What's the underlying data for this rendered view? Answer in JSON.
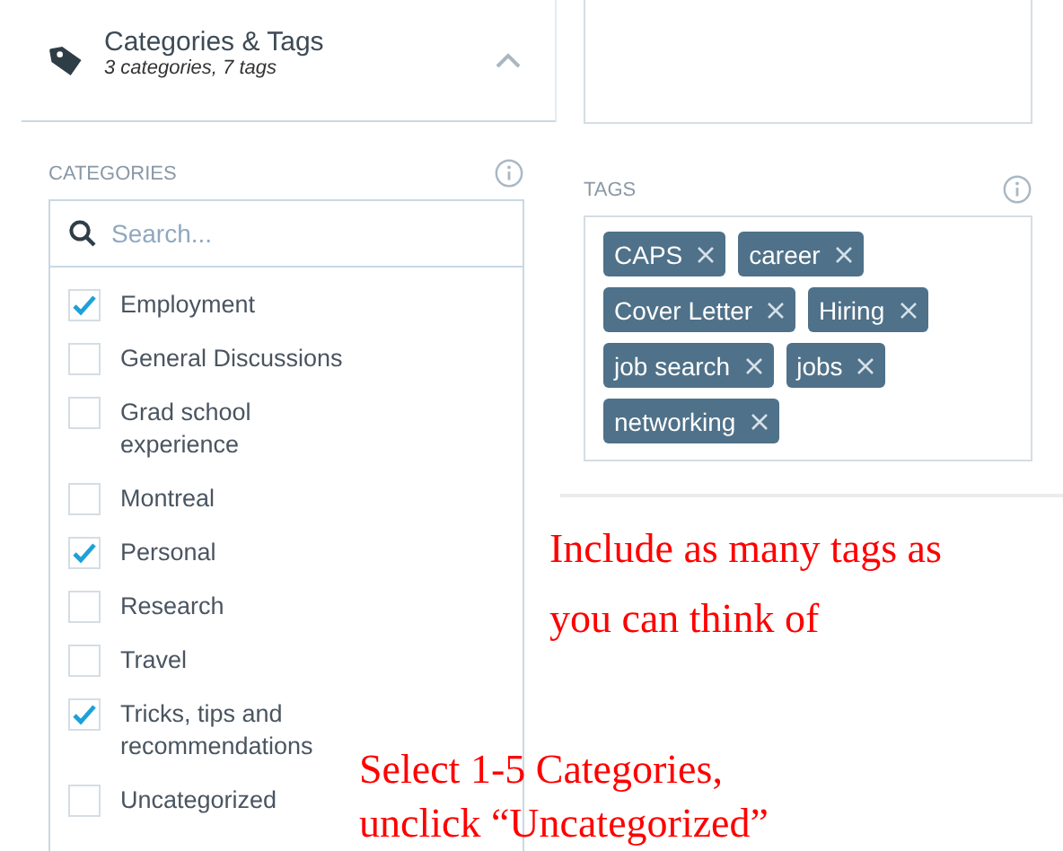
{
  "header": {
    "title": "Categories & Tags",
    "subtitle": "3 categories, 7 tags",
    "expanded": true
  },
  "categories": {
    "label": "CATEGORIES",
    "search_placeholder": "Search...",
    "items": [
      {
        "label": "Employment",
        "checked": true
      },
      {
        "label": "General Discussions",
        "checked": false
      },
      {
        "label": "Grad school experience",
        "checked": false
      },
      {
        "label": "Montreal",
        "checked": false
      },
      {
        "label": "Personal",
        "checked": true
      },
      {
        "label": "Research",
        "checked": false
      },
      {
        "label": "Travel",
        "checked": false
      },
      {
        "label": "Tricks, tips and recommendations",
        "checked": true
      },
      {
        "label": "Uncategorized",
        "checked": false
      }
    ]
  },
  "tags": {
    "label": "TAGS",
    "items": [
      "CAPS",
      "career",
      "Cover Letter",
      "Hiring",
      "job search",
      "jobs",
      "networking"
    ]
  },
  "annotations": [
    {
      "lines": [
        "Include as many tags as",
        "you can think of"
      ]
    },
    {
      "lines": [
        "Select 1-5 Categories,",
        "unclick “Uncategorized”"
      ]
    }
  ]
}
